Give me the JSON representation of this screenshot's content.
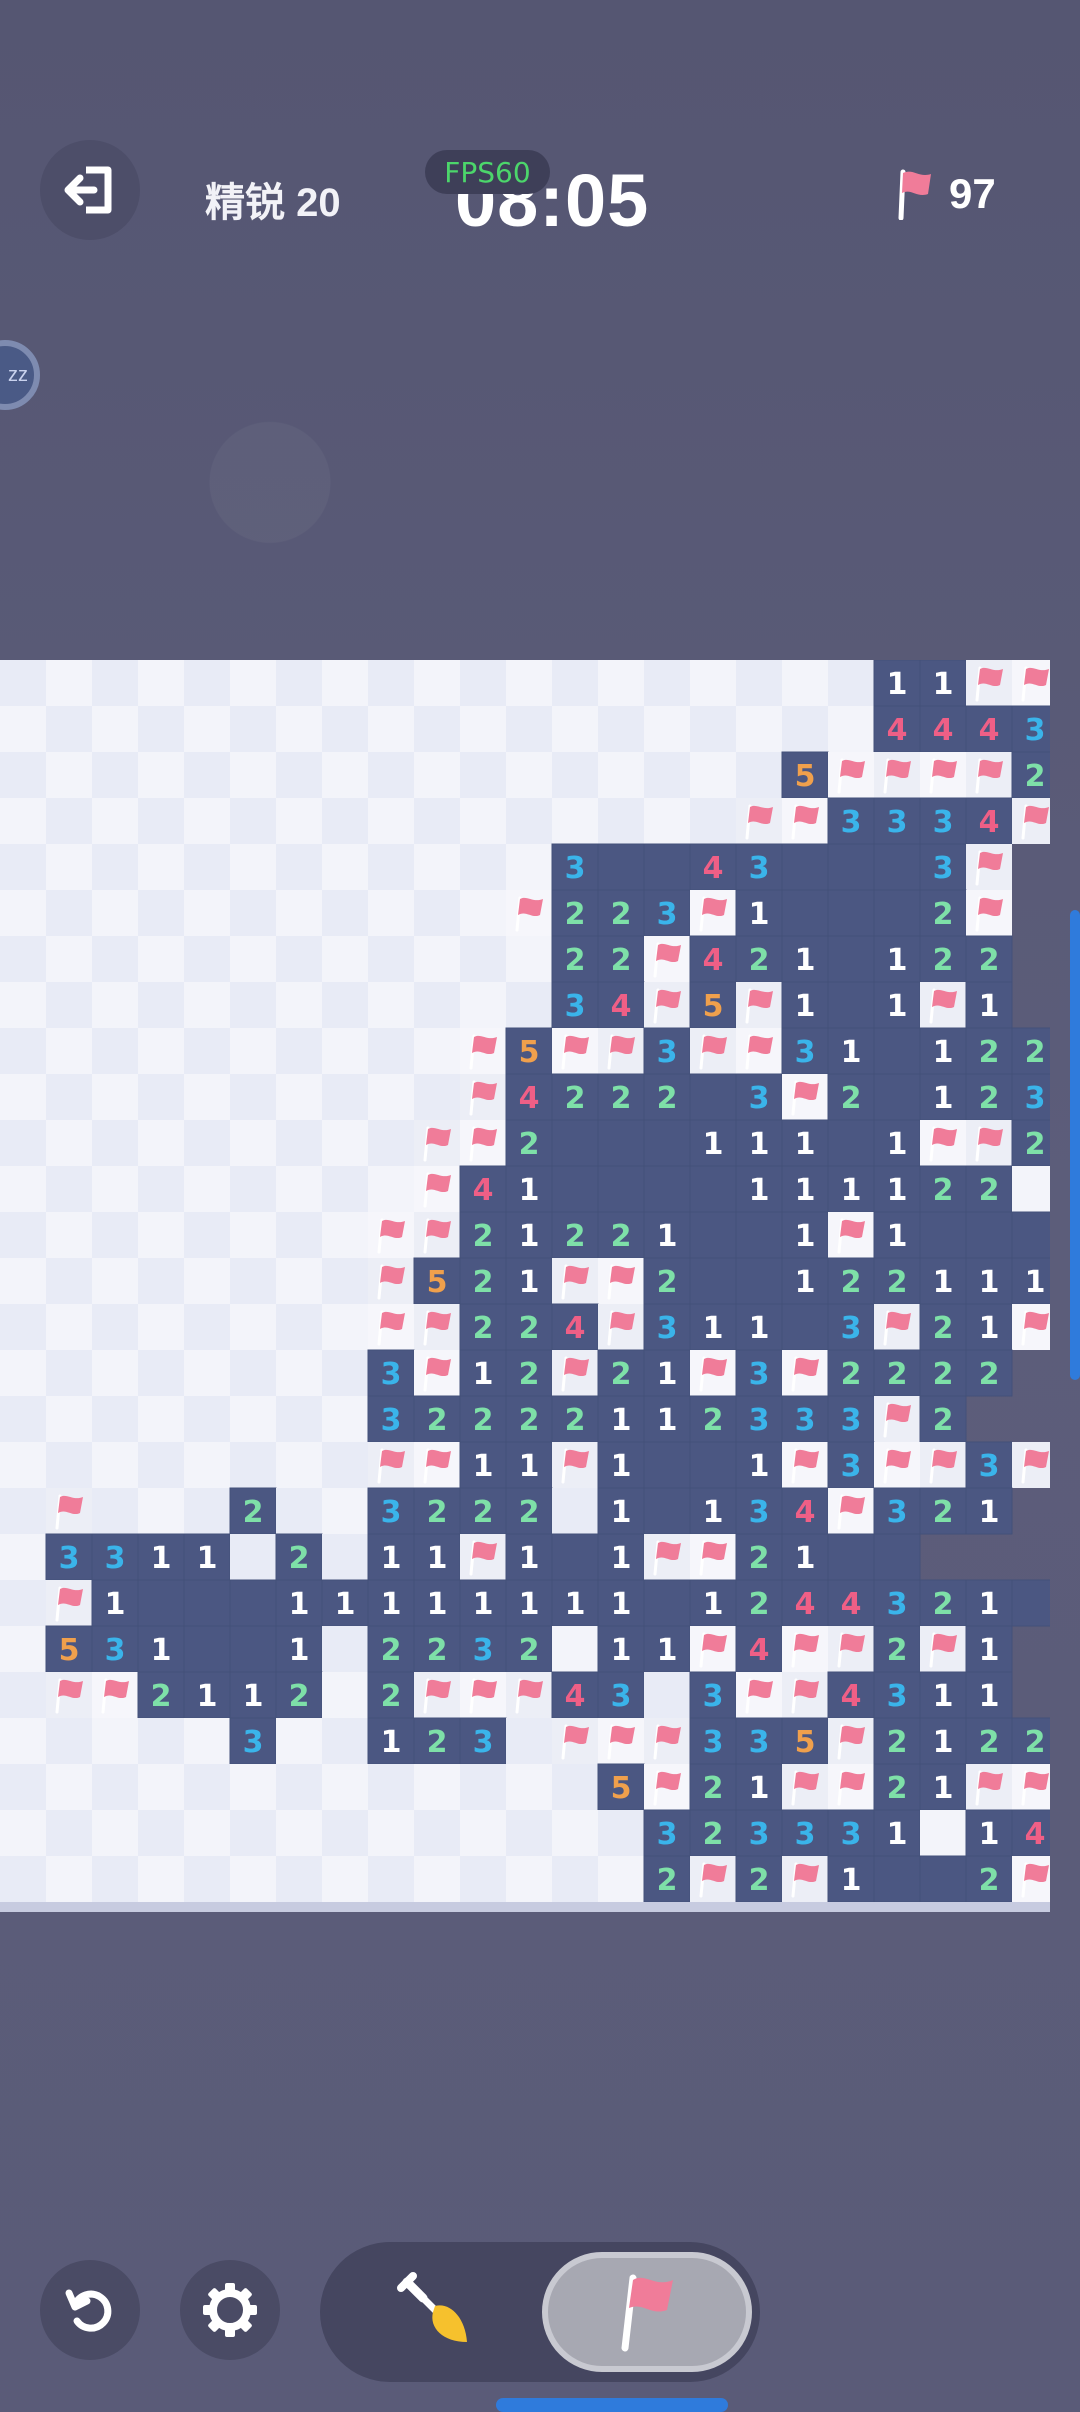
{
  "hud": {
    "level": "精锐 20",
    "fps": "FPS60",
    "timer": "08:05",
    "flags_left": "97"
  },
  "icons": {
    "exit": "exit-icon",
    "flag": "flag-icon",
    "restart": "restart-icon",
    "settings": "gear-icon",
    "dig": "shovel-icon",
    "flag_tool": "flag-icon"
  },
  "side_bubble": {
    "text": "zz"
  },
  "colors": {
    "hidden_a": "#e8ebf6",
    "hidden_b": "#f3f4fa",
    "open": "#4b5782",
    "flag": "#f07c99",
    "n1": "#ffffff",
    "n2": "#7ee0a8",
    "n3": "#3ab4ea",
    "n4": "#ef5f86",
    "n5": "#f0a04c"
  },
  "board": {
    "rows": [
      "...................11FF",
      "...................4443",
      ".................5FFFF2",
      "................FF3334F",
      "............3##43#__3F",
      "...........F223F1___2F",
      "............22F421_122",
      "............34F5F1_1F1",
      "..........F5FF3FF31_122",
      "..........F4222_3F2_123F",
      ".........FF2___111_1FF2",
      ".........F41____111122 1",
      "........FF21221__1F1___",
      "........F521FF2__1221111",
      "........FF224F311_3F21F1",
      "........3F12F21F3F2222",
      "........32222112333F2",
      "........FF11F1__1F3FF3F",
      ".F...2..3222 1_134F321",
      ".3311 2.11F1_1FF21__",
      ".F1___11111111_1244321_1",
      ".531__1.2232 11F4FF2F1",
      ".FF2112.2FFF43 3FF4311",
      ".....3..123.FFF335F2122",
      ".............5F21FF21FF",
      "..............323331 14F",
      "..............2F2F1__2F"
    ]
  }
}
